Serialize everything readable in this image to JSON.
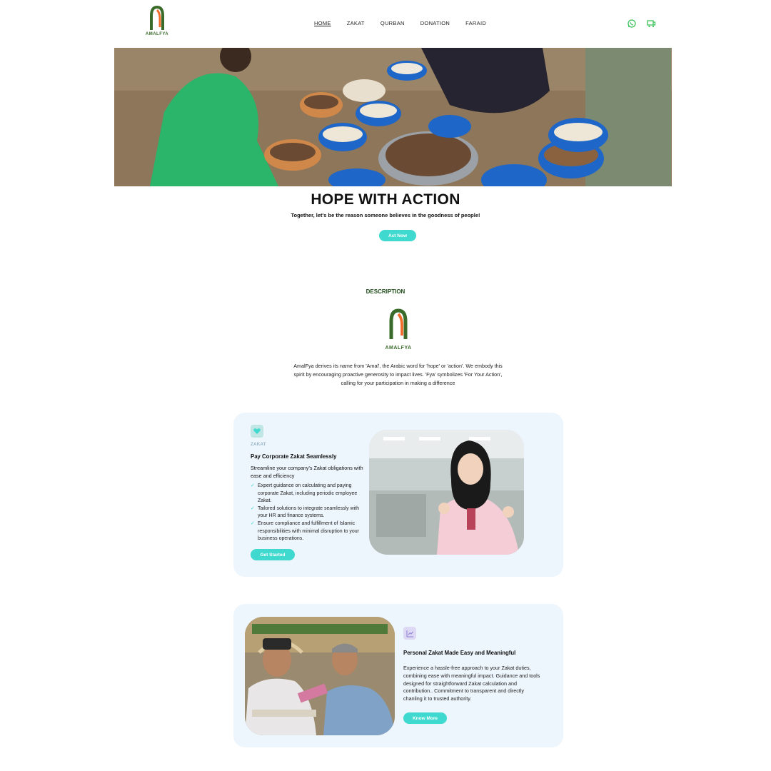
{
  "header": {
    "logo_text": "AMALFYA",
    "nav": [
      "HOME",
      "ZAKAT",
      "QURBAN",
      "DONATION",
      "FARAID"
    ],
    "icons": [
      "whatsapp-icon",
      "cart-icon"
    ],
    "accent": "#3fd9cf"
  },
  "hero": {
    "title": "HOPE WITH ACTION",
    "subtitle": "Together, let's be the reason someone believes in the goodness of people!",
    "cta": "Act Now"
  },
  "description": {
    "heading": "DESCRIPTION",
    "logo_text": "AMALFYA",
    "text": "AmalFya derives its name from 'Amal', the Arabic word for 'hope' or 'action'. We embody this spirit by encouraging proactive generosity to impact lives. 'Fya' symbolizes 'For Your Action', calling for your participation in making a difference"
  },
  "zakat_card": {
    "label": "ZAKAT",
    "title": "Pay Corporate Zakat Seamlessly",
    "subtitle": "Streamline your company's Zakat obligations with ease and efficiency",
    "items": [
      "Expert guidance on calculating and paying corporate Zakat, including periodic employee Zakat.",
      "Tailored solutions to integrate seamlessly with your HR and finance systems.",
      "Ensure compliance and fulfillment of Islamic responsibilities  with minimal disruption to your business operations."
    ],
    "cta": "Get Started"
  },
  "personal_card": {
    "title": "Personal Zakat Made Easy and Meaningful",
    "text": "Experience a hassle-free approach to your Zakat duties, combining ease with meaningful impact. Guidance and tools designed for straightforward Zakat calculation and contribution.. Commitment to transparent and directly chanling it to trusted authority.",
    "cta": "Know More"
  }
}
